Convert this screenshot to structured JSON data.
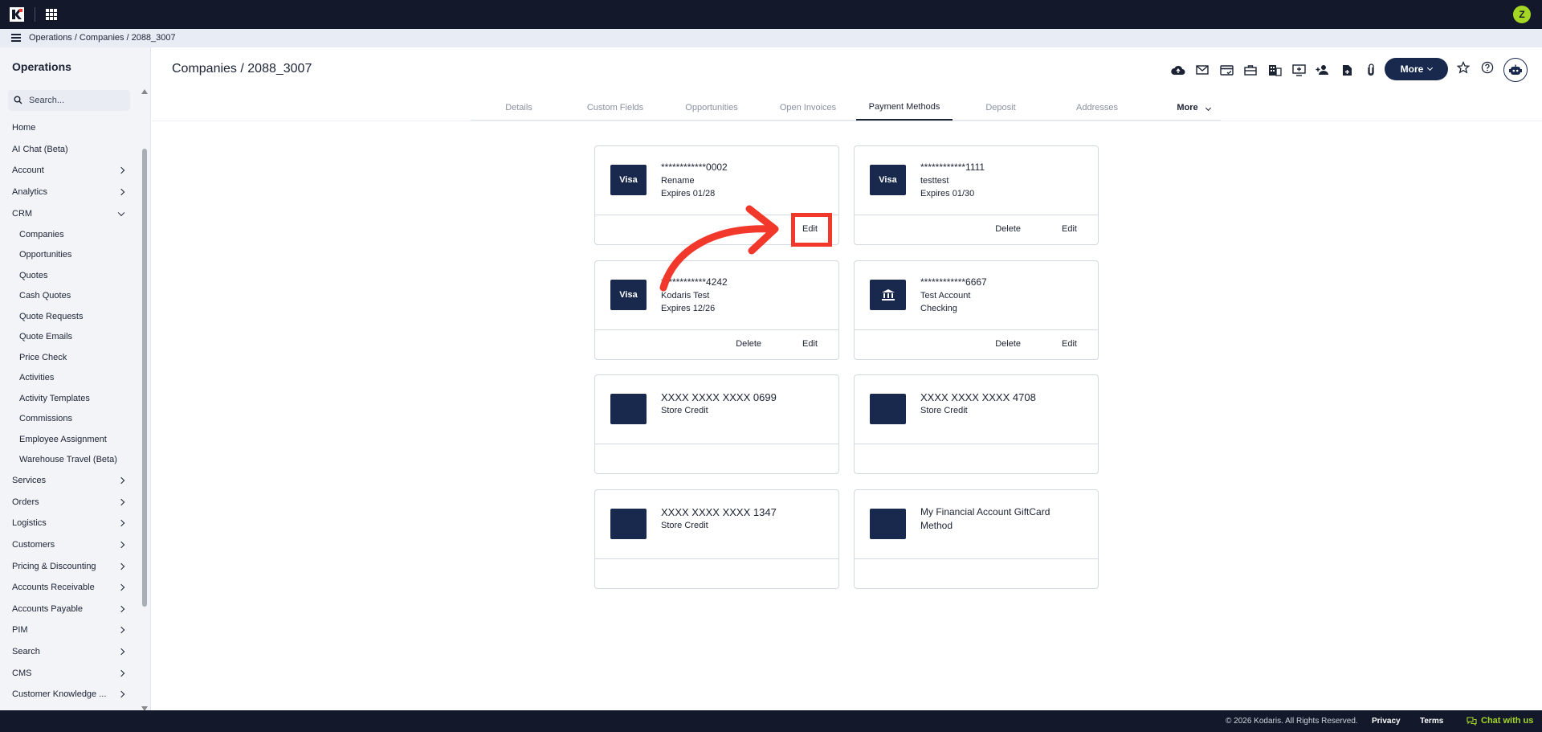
{
  "topbar": {
    "avatar_initial": "Z"
  },
  "breadcrumb": [
    "Operations",
    "/",
    "Companies",
    "/",
    "2088_3007"
  ],
  "sidebar": {
    "title": "Operations",
    "search_placeholder": "Search...",
    "items": [
      {
        "label": "Home",
        "type": "top",
        "chevron": "none"
      },
      {
        "label": "AI Chat (Beta)",
        "type": "top",
        "chevron": "none"
      },
      {
        "label": "Account",
        "type": "top",
        "chevron": "right"
      },
      {
        "label": "Analytics",
        "type": "top",
        "chevron": "right"
      },
      {
        "label": "CRM",
        "type": "top",
        "chevron": "down"
      },
      {
        "label": "Companies",
        "type": "sub",
        "chevron": "none"
      },
      {
        "label": "Opportunities",
        "type": "sub",
        "chevron": "none"
      },
      {
        "label": "Quotes",
        "type": "sub",
        "chevron": "none"
      },
      {
        "label": "Cash Quotes",
        "type": "sub",
        "chevron": "none"
      },
      {
        "label": "Quote Requests",
        "type": "sub",
        "chevron": "none"
      },
      {
        "label": "Quote Emails",
        "type": "sub",
        "chevron": "none"
      },
      {
        "label": "Price Check",
        "type": "sub",
        "chevron": "none"
      },
      {
        "label": "Activities",
        "type": "sub",
        "chevron": "none"
      },
      {
        "label": "Activity Templates",
        "type": "sub",
        "chevron": "none"
      },
      {
        "label": "Commissions",
        "type": "sub",
        "chevron": "none"
      },
      {
        "label": "Employee Assignment",
        "type": "sub",
        "chevron": "none"
      },
      {
        "label": "Warehouse Travel (Beta)",
        "type": "sub",
        "chevron": "none"
      },
      {
        "label": "Services",
        "type": "top",
        "chevron": "right"
      },
      {
        "label": "Orders",
        "type": "top",
        "chevron": "right"
      },
      {
        "label": "Logistics",
        "type": "top",
        "chevron": "right"
      },
      {
        "label": "Customers",
        "type": "top",
        "chevron": "right"
      },
      {
        "label": "Pricing & Discounting",
        "type": "top",
        "chevron": "right"
      },
      {
        "label": "Accounts Receivable",
        "type": "top",
        "chevron": "right"
      },
      {
        "label": "Accounts Payable",
        "type": "top",
        "chevron": "right"
      },
      {
        "label": "PIM",
        "type": "top",
        "chevron": "right"
      },
      {
        "label": "Search",
        "type": "top",
        "chevron": "right"
      },
      {
        "label": "CMS",
        "type": "top",
        "chevron": "right"
      },
      {
        "label": "Customer Knowledge ...",
        "type": "top",
        "chevron": "right"
      }
    ]
  },
  "header": {
    "title": "Companies / 2088_3007",
    "more_label": "More",
    "toolbar_icons": [
      "cloud-icon",
      "mail-icon",
      "card-check-icon",
      "briefcase-icon",
      "building-icon",
      "monitor-plus-icon",
      "person-add-icon",
      "file-plus-icon",
      "paperclip-icon"
    ]
  },
  "tabs": [
    {
      "label": "Details",
      "active": false
    },
    {
      "label": "Custom Fields",
      "active": false
    },
    {
      "label": "Opportunities",
      "active": false
    },
    {
      "label": "Open Invoices",
      "active": false
    },
    {
      "label": "Payment Methods",
      "active": true
    },
    {
      "label": "Deposit",
      "active": false
    },
    {
      "label": "Addresses",
      "active": false
    },
    {
      "label": "More",
      "active": false
    }
  ],
  "cards": [
    {
      "brand": "Visa",
      "icon": "",
      "line1": "************0002",
      "line2": "Rename",
      "line3": "Expires 01/28",
      "delete": "",
      "edit": "Edit"
    },
    {
      "brand": "Visa",
      "icon": "",
      "line1": "************1111",
      "line2": "testtest",
      "line3": "Expires 01/30",
      "delete": "Delete",
      "edit": "Edit"
    },
    {
      "brand": "Visa",
      "icon": "",
      "line1": "************4242",
      "line2": "Kodaris Test",
      "line3": "Expires 12/26",
      "delete": "Delete",
      "edit": "Edit"
    },
    {
      "brand": "",
      "icon": "bank-icon",
      "line1": "************6667",
      "line2": "Test Account",
      "line3": "Checking",
      "delete": "Delete",
      "edit": "Edit"
    },
    {
      "brand": "",
      "icon": "",
      "line1": "XXXX XXXX XXXX 0699",
      "line2": "Store Credit",
      "line3": "",
      "delete": "",
      "edit": ""
    },
    {
      "brand": "",
      "icon": "",
      "line1": "XXXX XXXX XXXX 4708",
      "line2": "Store Credit",
      "line3": "",
      "delete": "",
      "edit": ""
    },
    {
      "brand": "",
      "icon": "",
      "line1": "XXXX XXXX XXXX 1347",
      "line2": "Store Credit",
      "line3": "",
      "delete": "",
      "edit": ""
    },
    {
      "brand": "",
      "icon": "",
      "line1": "My Financial Account GiftCard Method",
      "line2": "",
      "line3": "",
      "delete": "",
      "edit": ""
    }
  ],
  "annotation": {
    "color": "#f2372b"
  },
  "footer": {
    "copyright": "© 2026 Kodaris. All Rights Reserved.",
    "privacy": "Privacy",
    "terms": "Terms",
    "chat": "Chat with us"
  },
  "colors": {
    "navy": "#18294d",
    "topbar": "#13192b",
    "accent_green": "#a4d624"
  }
}
